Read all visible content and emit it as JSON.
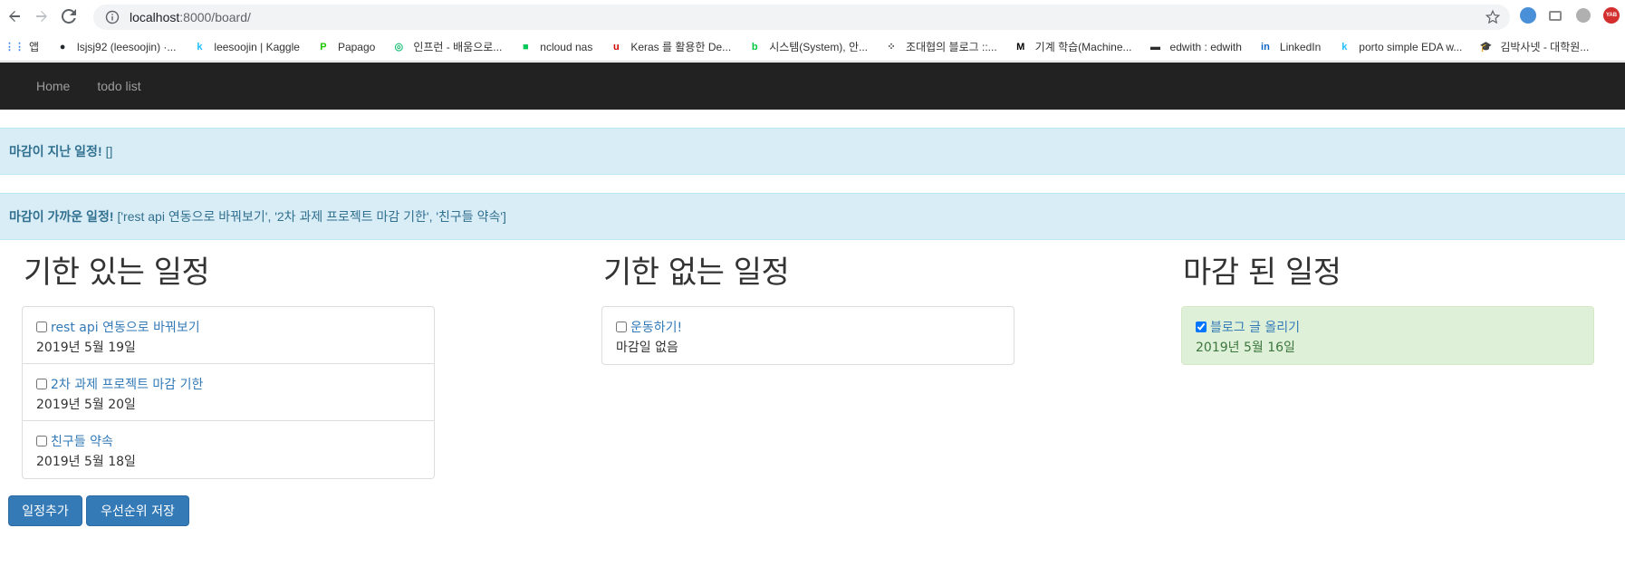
{
  "browser": {
    "url_host": "localhost",
    "url_path": ":8000/board/"
  },
  "bookmarks": [
    {
      "label": "앱",
      "icon": "apps-grid-icon",
      "color": "#4285f4",
      "glyph": "⋮⋮"
    },
    {
      "label": "lsjsj92 (leesoojin) ·...",
      "icon": "github-icon",
      "color": "#24292e",
      "glyph": "●"
    },
    {
      "label": "leesoojin | Kaggle",
      "icon": "kaggle-icon",
      "color": "#20beff",
      "glyph": "k"
    },
    {
      "label": "Papago",
      "icon": "papago-icon",
      "color": "#1ec800",
      "glyph": "P"
    },
    {
      "label": "인프런 - 배움으로...",
      "icon": "inflearn-icon",
      "color": "#1dc078",
      "glyph": "◎"
    },
    {
      "label": "ncloud nas",
      "icon": "ncloud-icon",
      "color": "#03c75a",
      "glyph": "■"
    },
    {
      "label": "Keras 를 활용한 De...",
      "icon": "keras-icon",
      "color": "#d00000",
      "glyph": "u"
    },
    {
      "label": "시스템(System), 안...",
      "icon": "blog-icon",
      "color": "#00c73c",
      "glyph": "b"
    },
    {
      "label": "조대협의 블로그 ::...",
      "icon": "tistory-icon",
      "color": "#333333",
      "glyph": "⁘"
    },
    {
      "label": "기계 학습(Machine...",
      "icon": "medium-icon",
      "color": "#000000",
      "glyph": "M"
    },
    {
      "label": "edwith : edwith",
      "icon": "edwith-icon",
      "color": "#2b2b2b",
      "glyph": "▬"
    },
    {
      "label": "LinkedIn",
      "icon": "linkedin-icon",
      "color": "#0a66c2",
      "glyph": "in"
    },
    {
      "label": "porto simple EDA w...",
      "icon": "kaggle-icon",
      "color": "#20beff",
      "glyph": "k"
    },
    {
      "label": "김박사넷 - 대학원...",
      "icon": "graduation-cap-icon",
      "color": "#222222",
      "glyph": "🎓"
    }
  ],
  "navbar": {
    "items": [
      "Home",
      "todo list"
    ]
  },
  "alerts": {
    "overdue": {
      "label": "마감이 지난 일정!",
      "text": "[]"
    },
    "upcoming": {
      "label": "마감이 가까운 일정!",
      "text": "['rest api 연동으로 바꿔보기', '2차 과제 프로젝트 마감 기한', '친구들 약속']"
    }
  },
  "columns": {
    "with_deadline": {
      "title": "기한 있는 일정",
      "items": [
        {
          "title": "rest api 연동으로 바꿔보기",
          "due": "2019년 5월 19일",
          "checked": false
        },
        {
          "title": "2차 과제 프로젝트 마감 기한",
          "due": "2019년 5월 20일",
          "checked": false
        },
        {
          "title": "친구들 약속",
          "due": "2019년 5월 18일",
          "checked": false
        }
      ]
    },
    "no_deadline": {
      "title": "기한 없는 일정",
      "items": [
        {
          "title": "운동하기!",
          "due": "마감일 없음",
          "checked": false
        }
      ]
    },
    "completed": {
      "title": "마감 된 일정",
      "items": [
        {
          "title": "블로그 글 올리기",
          "due": "2019년 5월 16일",
          "checked": true
        }
      ]
    }
  },
  "buttons": {
    "add": "일정추가",
    "save_priority": "우선순위 저장"
  },
  "colors": {
    "navbar_bg": "#222222",
    "alert_bg": "#d9edf7",
    "alert_text": "#31708f",
    "link": "#337ab7",
    "primary_button": "#337ab7",
    "done_bg": "#dff0d8",
    "done_text": "#3c763d"
  }
}
